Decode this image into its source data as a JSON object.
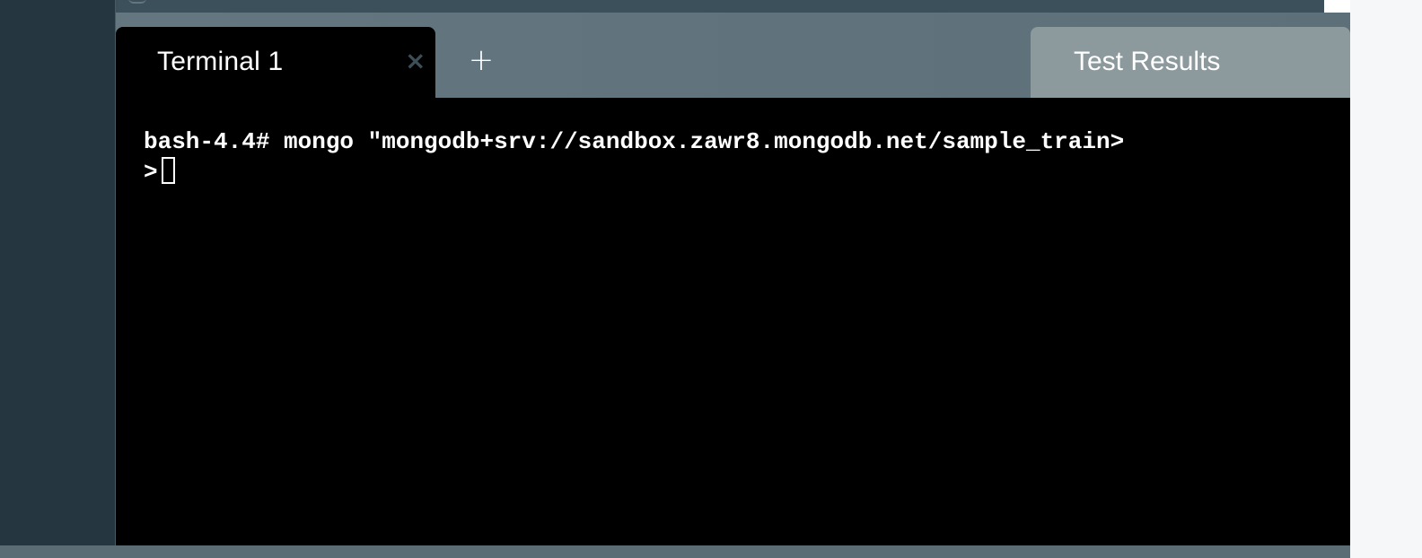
{
  "tabs": {
    "active_label": "Terminal 1",
    "close_glyph": "×",
    "add_glyph": "+",
    "results_label": "Test Results"
  },
  "terminal": {
    "command_line": "bash-4.4# mongo \"mongodb+srv://sandbox.zawr8.mongodb.net/sample_train>",
    "prompt": ">"
  },
  "colors": {
    "rail": "#253640",
    "tabbar": "#647780",
    "terminal_bg": "#000000",
    "results_tab": "#8c9a9e",
    "text": "#ffffff"
  },
  "icons": [
    "close-icon",
    "plus-icon",
    "cursor-block"
  ]
}
